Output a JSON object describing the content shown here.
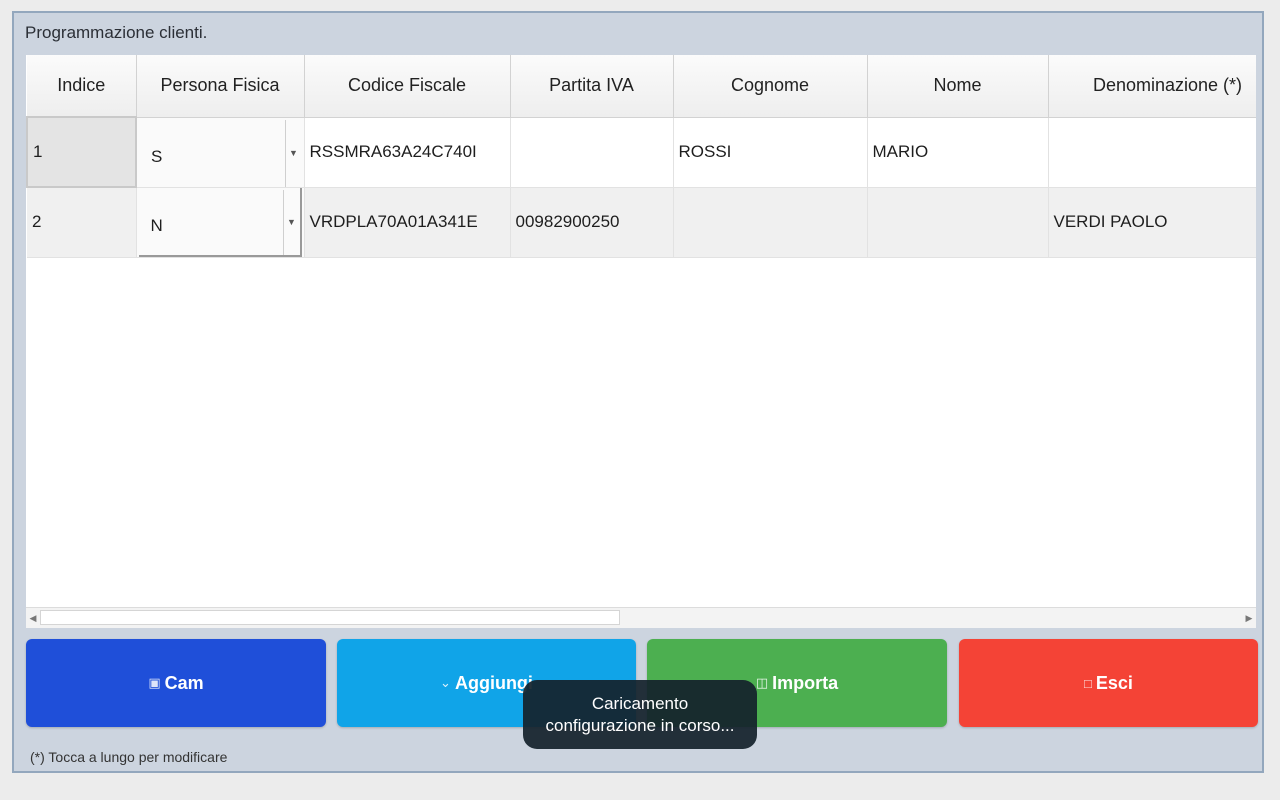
{
  "dialog": {
    "title": "Programmazione clienti.",
    "footnote": "(*) Tocca a lungo per modificare"
  },
  "table": {
    "columns": [
      "Indice",
      "Persona Fisica",
      "Codice Fiscale",
      "Partita IVA",
      "Cognome",
      "Nome",
      "Denominazione (*)"
    ],
    "rows": [
      {
        "indice": "1",
        "persona_fisica": "S",
        "codice_fiscale": "RSSMRA63A24C740I",
        "partita_iva": "",
        "cognome": "ROSSI",
        "nome": "MARIO",
        "denominazione": ""
      },
      {
        "indice": "2",
        "persona_fisica": "N",
        "codice_fiscale": "VRDPLA70A01A341E",
        "partita_iva": "00982900250",
        "cognome": "",
        "nome": "",
        "denominazione": "VERDI PAOLO"
      }
    ]
  },
  "buttons": {
    "cam": "Cam",
    "aggiungi": "Aggiungi",
    "importa": "Importa",
    "esci": "Esci"
  },
  "toast": {
    "line1": "Caricamento",
    "line2": "configurazione in corso..."
  },
  "icons": {
    "cam": "camera-icon",
    "aggiungi": "chevron-down-icon",
    "importa": "folder-icon",
    "esci": "exit-icon"
  },
  "colors": {
    "cam": "#1f4fd9",
    "aggiungi": "#10a4e8",
    "importa": "#4caf50",
    "esci": "#f44336"
  }
}
